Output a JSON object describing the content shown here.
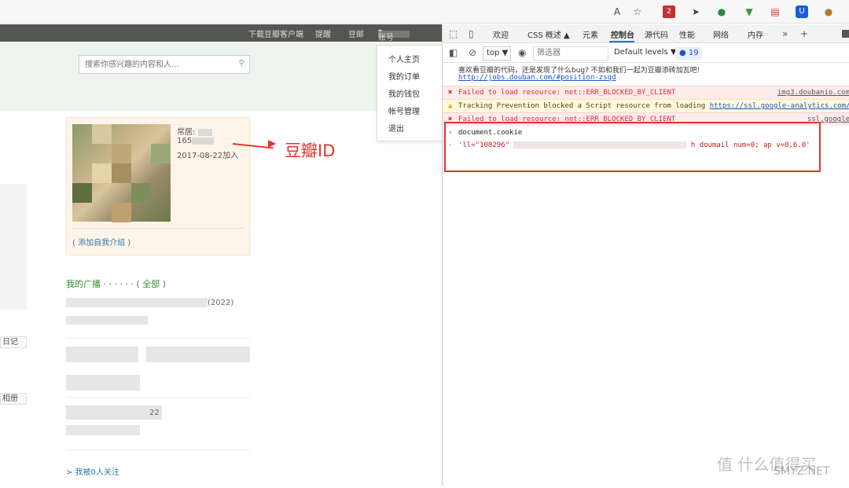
{
  "browser": {
    "reader_icon": "Aᴬ",
    "ext_badge": "2"
  },
  "douban": {
    "topnav": [
      "下载豆瓣客户端",
      "提醒",
      "豆邮",
      "账号"
    ],
    "search_placeholder": "搜索你感兴趣的内容和人...",
    "dropdown": [
      "个人主页",
      "我的订单",
      "我的钱包",
      "帐号管理",
      "退出"
    ],
    "profile": {
      "location_label": "常居:",
      "id_prefix": "165",
      "joined": "2017-08-22加入",
      "add_intro": "( 添加自我介绍 )"
    },
    "annotation": "豆瓣ID",
    "broadcast_title": "我的广播 · · · · · · ( 全部 )",
    "feed_year": "(2022)",
    "feed_year2": "22",
    "followers": "> 我被0人关注",
    "side_tags": [
      "日记",
      "相册"
    ]
  },
  "devtools": {
    "tabs": [
      "欢迎",
      "CSS 概述",
      "元素",
      "控制台",
      "源代码",
      "性能",
      "网络",
      "内存"
    ],
    "active_tab": "控制台",
    "context": "top",
    "filter_placeholder": "筛选器",
    "levels": "Default levels",
    "issue_count": "19",
    "console": {
      "greeting_line1": "喜欢看豆瓣的代码，还是发现了什么bug? 不如和我们一起为豆瓣添砖加瓦吧!",
      "greeting_link": "http://jobs.douban.com/#position-zsqd",
      "error1": "Failed to load resource: net::ERR_BLOCKED_BY_CLIENT",
      "error1_src": "img3.doubanio.com",
      "warning": "Tracking Prevention blocked a Script resource from loading",
      "warning_link": "https://ssl.google-analytics.com/ga.js",
      "error2": "Failed to load resource: net::ERR_BLOCKED_BY_CLIENT",
      "error2_src": "ssl.google",
      "command": "document.cookie",
      "result_start": "'ll=\"108296\"",
      "result_end": "h doumail num=0; ap v=0,6.0'"
    }
  },
  "watermark": {
    "main": "值 什么值得买",
    "sub": "SMYZ.NET"
  }
}
